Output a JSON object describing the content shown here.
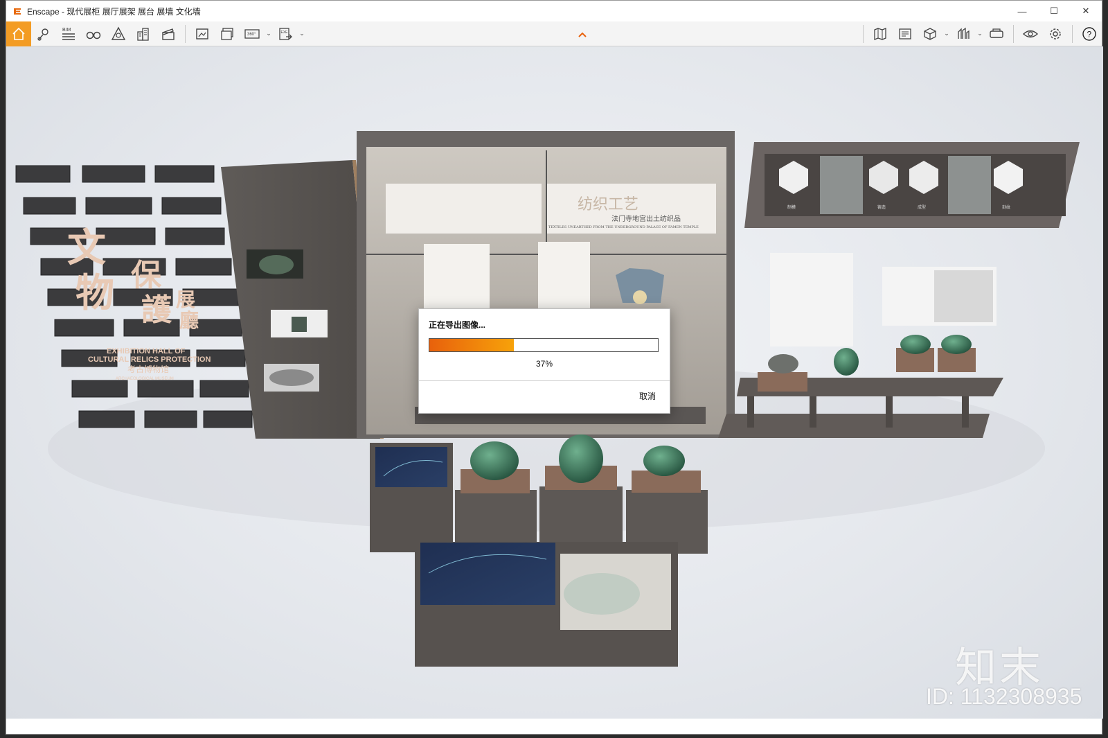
{
  "window": {
    "title": "Enscape - 现代展柜 展厅展架 展台 展墙 文化墙",
    "controls": {
      "minimize": "—",
      "maximize": "☐",
      "close": "✕"
    }
  },
  "toolbar": {
    "left": [
      {
        "name": "home-icon",
        "active": true
      },
      {
        "name": "location-pin-icon"
      },
      {
        "name": "bim-icon",
        "label": "BIM"
      },
      {
        "name": "binoculars-icon"
      },
      {
        "name": "asset-library-icon"
      },
      {
        "name": "buildings-icon"
      },
      {
        "name": "clapperboard-icon"
      },
      {
        "name": "screenshot-icon"
      },
      {
        "name": "batch-render-icon"
      },
      {
        "name": "panorama-360-icon",
        "label": "360°",
        "dropdown": true
      },
      {
        "name": "export-exe-icon",
        "label": "EXE",
        "dropdown": true
      }
    ],
    "right": [
      {
        "name": "map-icon"
      },
      {
        "name": "capture-view-icon"
      },
      {
        "name": "cube-icon",
        "dropdown": true
      },
      {
        "name": "sync-icon",
        "dropdown": true
      },
      {
        "name": "vr-headset-icon"
      },
      {
        "name": "eye-icon"
      },
      {
        "name": "settings-gear-icon"
      },
      {
        "name": "help-icon",
        "label": "?"
      }
    ]
  },
  "dialog": {
    "title": "正在导出图像...",
    "progress": 0.37,
    "progress_label": "37%",
    "cancel_label": "取消"
  },
  "scene": {
    "wall_sign": {
      "title_chars": "文物保護展廳",
      "english_1": "EXHIBITION HALL OF",
      "english_2": "CULTURAL RELICS PROTECTION",
      "subtitle_cn": "考古博物馆",
      "subtitle_en": "ARCHAEOLOGICAL MUSEUM"
    },
    "showcase": {
      "title": "纺织工艺",
      "subtitle": "法门寺地宫出土纺织品",
      "english": "TEXTILES UNEARTHED FROM THE UNDERGROUND PALACE OF FAMEN TEMPLE"
    },
    "panel_labels": [
      "制模",
      "铸造",
      "成型",
      "刻纹"
    ]
  },
  "watermark": {
    "logo": "知末",
    "id": "ID: 1132308935"
  }
}
